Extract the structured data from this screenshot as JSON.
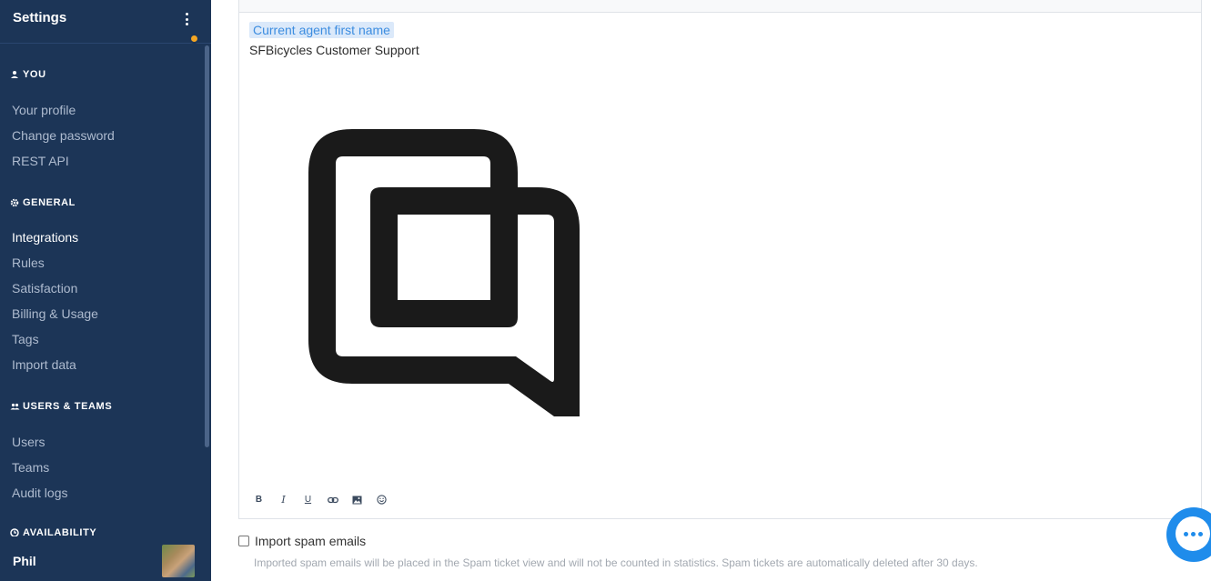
{
  "sidebar": {
    "title": "Settings",
    "sections": [
      {
        "label": "YOU",
        "icon": "user-icon",
        "items": [
          "Your profile",
          "Change password",
          "REST API"
        ]
      },
      {
        "label": "GENERAL",
        "icon": "gear-icon",
        "items": [
          "Integrations",
          "Rules",
          "Satisfaction",
          "Billing & Usage",
          "Tags",
          "Import data"
        ]
      },
      {
        "label": "USERS & TEAMS",
        "icon": "users-icon",
        "items": [
          "Users",
          "Teams",
          "Audit logs"
        ]
      },
      {
        "label": "AVAILABILITY",
        "icon": "clock-icon"
      }
    ],
    "active_item": "Integrations",
    "footer": {
      "user_name": "Phil",
      "status_color": "#f5a623"
    }
  },
  "editor": {
    "variable_chip": "Current agent first name",
    "signature_text": "SFBicycles Customer Support",
    "toolbar": [
      "bold-icon",
      "italic-icon",
      "underline-icon",
      "link-icon",
      "image-icon",
      "emoji-icon"
    ]
  },
  "spam": {
    "label": "Import spam emails",
    "help": "Imported spam emails will be placed in the Spam ticket view and will not be counted in statistics. Spam tickets are automatically deleted after 30 days.",
    "checked": false
  },
  "colors": {
    "sidebar_bg": "#1c3557",
    "accent": "#1f8ceb",
    "chip_bg": "#dbe9fa"
  }
}
